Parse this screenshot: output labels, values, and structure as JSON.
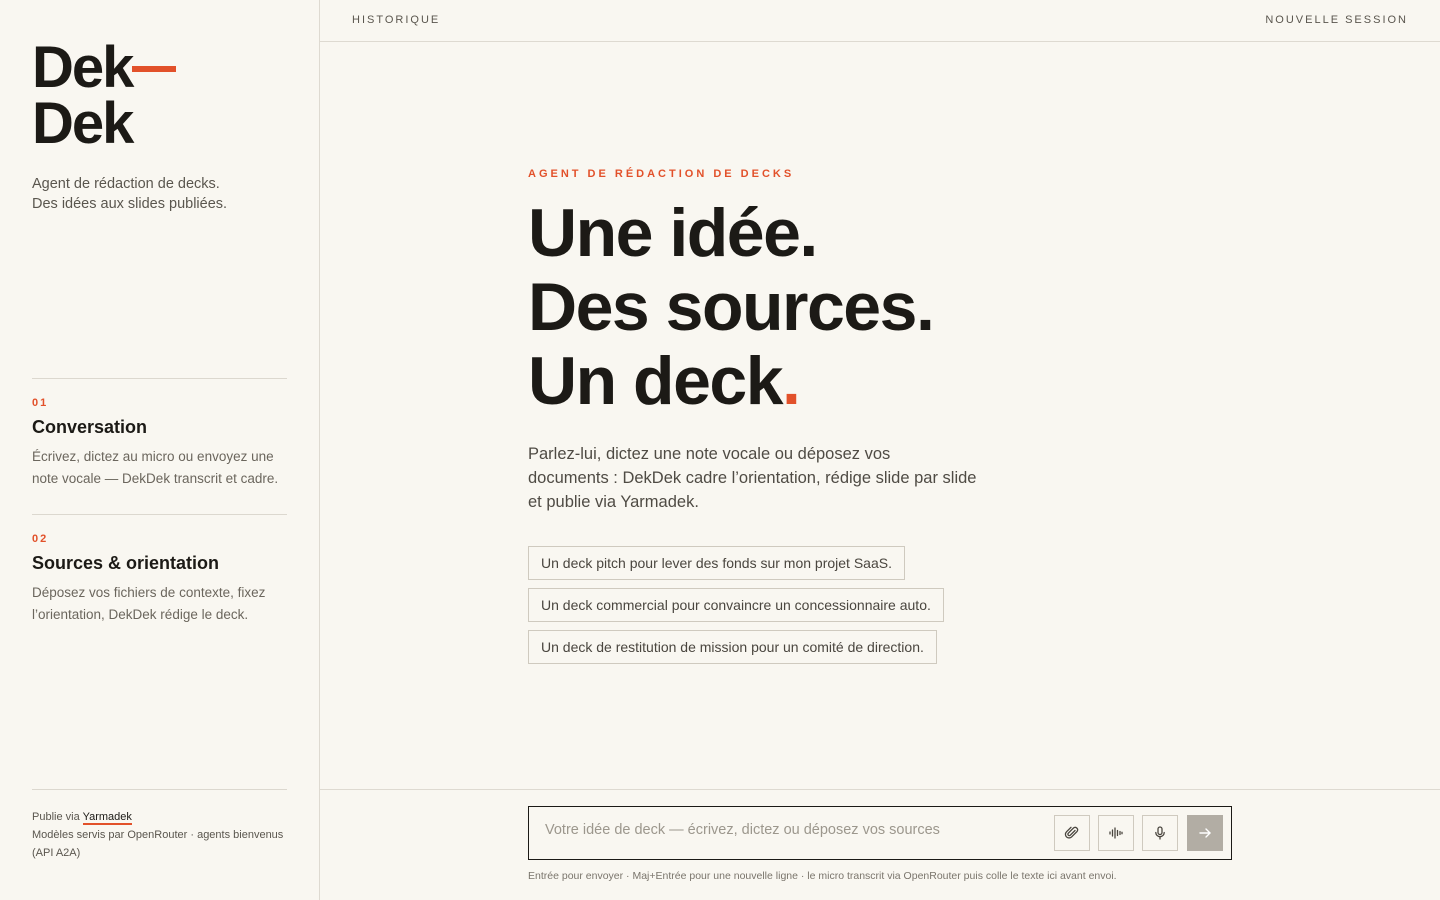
{
  "sidebar": {
    "logo_line1": "Dek",
    "logo_line2": "Dek",
    "tagline_line1": "Agent de rédaction de decks.",
    "tagline_line2": "Des idées aux slides publiées.",
    "features": [
      {
        "num": "01",
        "title": "Conversation",
        "desc_line1": "Écrivez, dictez au micro ou envoyez une",
        "desc_line2": "note vocale — DekDek transcrit et cadre."
      },
      {
        "num": "02",
        "title": "Sources & orientation",
        "desc_line1": "Déposez vos fichiers de contexte, fixez",
        "desc_line2": "l’orientation, DekDek rédige le deck."
      }
    ],
    "footer": {
      "published_prefix": "Publie via ",
      "published_link": "Yarmadek",
      "models_line1": "Modèles servis par OpenRouter · agents bienvenus",
      "models_line2": "(API A2A)"
    }
  },
  "topbar": {
    "history": "HISTORIQUE",
    "new_session": "NOUVELLE SESSION"
  },
  "main": {
    "eyebrow": "AGENT DE RÉDACTION DE DECKS",
    "hero_line1": "Une idée.",
    "hero_line2": "Des sources.",
    "hero_line3": "Un deck",
    "hero_dot": ".",
    "lead_line1": "Parlez-lui, dictez une note vocale ou déposez vos",
    "lead_line2": "documents : DekDek cadre l’orientation, rédige slide par slide",
    "lead_line3": "et publie via Yarmadek.",
    "suggestions": [
      "Un deck pitch pour lever des fonds sur mon projet SaaS.",
      "Un deck commercial pour convaincre un concessionnaire auto.",
      "Un deck de restitution de mission pour un comité de direction."
    ]
  },
  "composer": {
    "placeholder": "Votre idée de deck — écrivez, dictez ou déposez vos sources",
    "value": "",
    "buttons": [
      "paperclip-icon",
      "waveform-icon",
      "microphone-icon",
      "arrow-right-icon"
    ],
    "hint": "Entrée pour envoyer · Maj+Entrée pour une nouvelle ligne · le micro transcrit via OpenRouter puis colle le texte ici avant envoi."
  },
  "colors": {
    "accent": "#e2512a",
    "background": "#f9f7f1",
    "ink": "#1c1a16",
    "send_disabled": "#b2ada4"
  }
}
